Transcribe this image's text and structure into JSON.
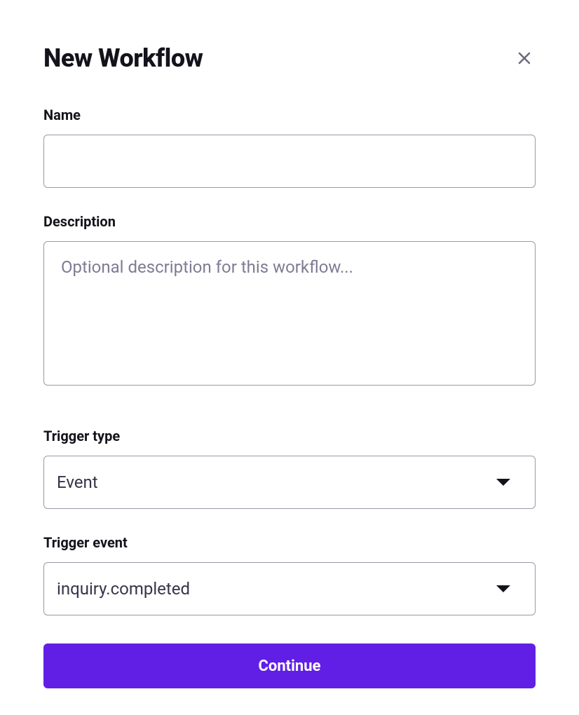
{
  "header": {
    "title": "New Workflow"
  },
  "form": {
    "name": {
      "label": "Name",
      "value": ""
    },
    "description": {
      "label": "Description",
      "placeholder": "Optional description for this workflow...",
      "value": ""
    },
    "trigger_type": {
      "label": "Trigger type",
      "value": "Event"
    },
    "trigger_event": {
      "label": "Trigger event",
      "value": "inquiry.completed"
    }
  },
  "actions": {
    "continue_label": "Continue"
  }
}
